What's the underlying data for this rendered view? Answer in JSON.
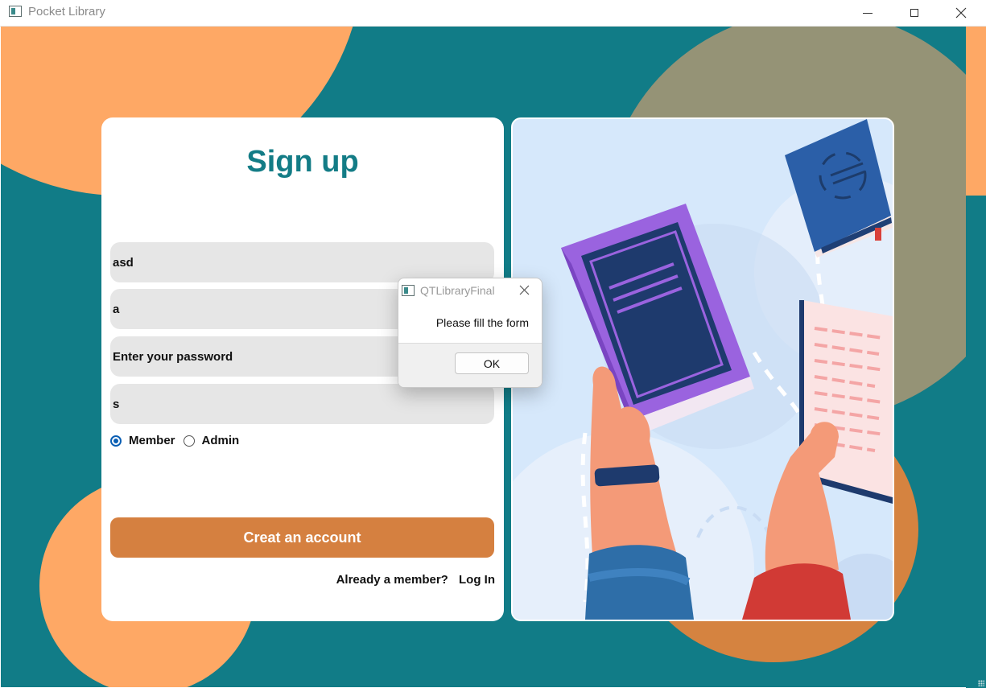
{
  "window": {
    "title": "Pocket Library"
  },
  "signup": {
    "title": "Sign up",
    "fields": [
      "asd",
      "a",
      "Enter your password",
      "s"
    ],
    "roles": [
      {
        "label": "Member",
        "checked": true
      },
      {
        "label": "Admin",
        "checked": false
      }
    ],
    "create_label": "Creat an account",
    "already_member": "Already a member?",
    "login_label": "Log In"
  },
  "dialog": {
    "title": "QTLibraryFinal",
    "message": "Please fill the form",
    "ok_label": "OK"
  },
  "colors": {
    "teal": "#117c87",
    "orange": "#fea865",
    "olive": "#959376",
    "button": "#d58040",
    "title_text": "#137c86"
  }
}
